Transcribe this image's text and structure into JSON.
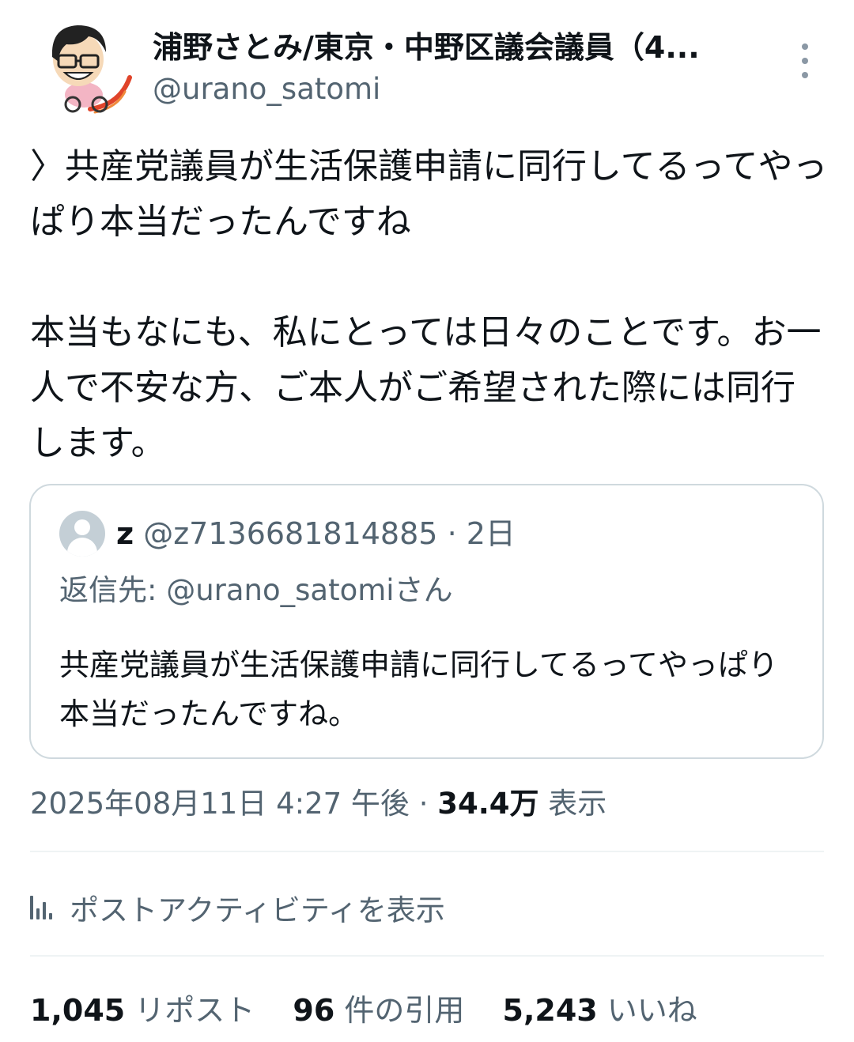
{
  "author": {
    "display_name": "浦野さとみ/東京・中野区議会議員（4...",
    "handle": "@urano_satomi"
  },
  "tweet": {
    "line1": "〉共産党議員が生活保護申請に同行してるってやっぱり本当だったんですね",
    "line2": "本当もなにも、私にとっては日々のことです。お一人で不安な方、ご本人がご希望された際には同行します。"
  },
  "quote": {
    "name": "z",
    "handle": "@z7136681814885",
    "separator": "·",
    "time": "2日",
    "reply_to": "返信先: @urano_satomiさん",
    "text": "共産党議員が生活保護申請に同行してるってやっぱり本当だったんですね。"
  },
  "meta": {
    "timestamp": "2025年08月11日 4:27 午後",
    "separator": "·",
    "views_count": "34.4万",
    "views_label": "表示"
  },
  "activity": {
    "label": "ポストアクティビティを表示",
    "icon": "bar-chart-icon"
  },
  "stats": {
    "reposts_count": "1,045",
    "reposts_label": "リポスト",
    "quotes_count": "96",
    "quotes_label": "件の引用",
    "likes_count": "5,243",
    "likes_label": "いいね"
  },
  "colors": {
    "text_primary": "#0f1419",
    "text_secondary": "#536471",
    "border": "#cfd9de",
    "divider": "#eff3f4"
  }
}
